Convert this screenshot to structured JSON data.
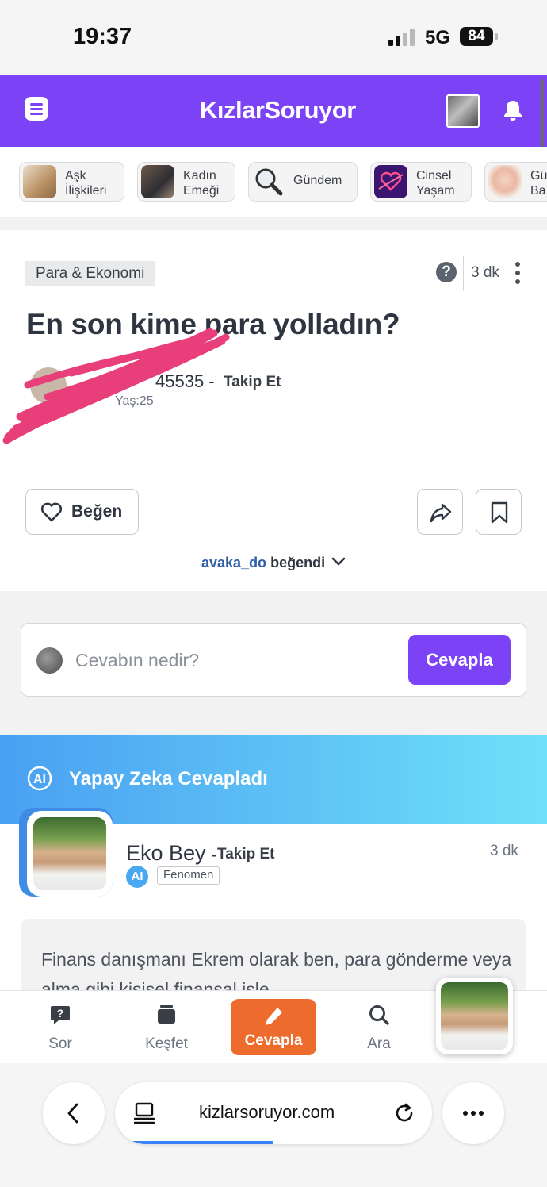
{
  "status_bar": {
    "time": "19:37",
    "network": "5G",
    "battery": "84"
  },
  "header": {
    "logo": "KızlarSoruyor"
  },
  "categories": [
    {
      "label": "Aşk İlişkileri"
    },
    {
      "label": "Kadın Emeği"
    },
    {
      "label": "Gündem"
    },
    {
      "label": "Cinsel Yaşam"
    },
    {
      "label": "Gü Ba"
    }
  ],
  "question": {
    "tag": "Para & Ekonomi",
    "time": "3 dk",
    "title": "En son kime para yolladın?",
    "author_name": "45535 -",
    "author_follow": "Takip Et",
    "author_age": "Yaş:25",
    "like_label": "Beğen",
    "liked_by_user": "avaka_do",
    "liked_by_suffix": "beğendi"
  },
  "composer": {
    "placeholder": "Cevabın nedir?",
    "button": "Cevapla"
  },
  "ai_banner": {
    "title": "Yapay Zeka Cevapladı",
    "badge": "AI"
  },
  "answer": {
    "name": "Eko Bey",
    "separator": "-",
    "follow": "Takip Et",
    "ai_badge": "AI",
    "badge": "Fenomen",
    "time": "3 dk",
    "text": "Finans danışmanı Ekrem olarak ben, para gönderme veya alma gibi kişisel finansal işle"
  },
  "bottom_nav": {
    "items": [
      {
        "label": "Sor"
      },
      {
        "label": "Keşfet"
      },
      {
        "label": "Cevapla"
      },
      {
        "label": "Ara"
      }
    ]
  },
  "browser": {
    "url": "kizlarsoruyor.com"
  },
  "colors": {
    "brand_purple": "#7b42f6",
    "accent_orange": "#ed6b2d",
    "ai_blue": "#4aa0f2",
    "redaction_pink": "#e83e7a"
  }
}
